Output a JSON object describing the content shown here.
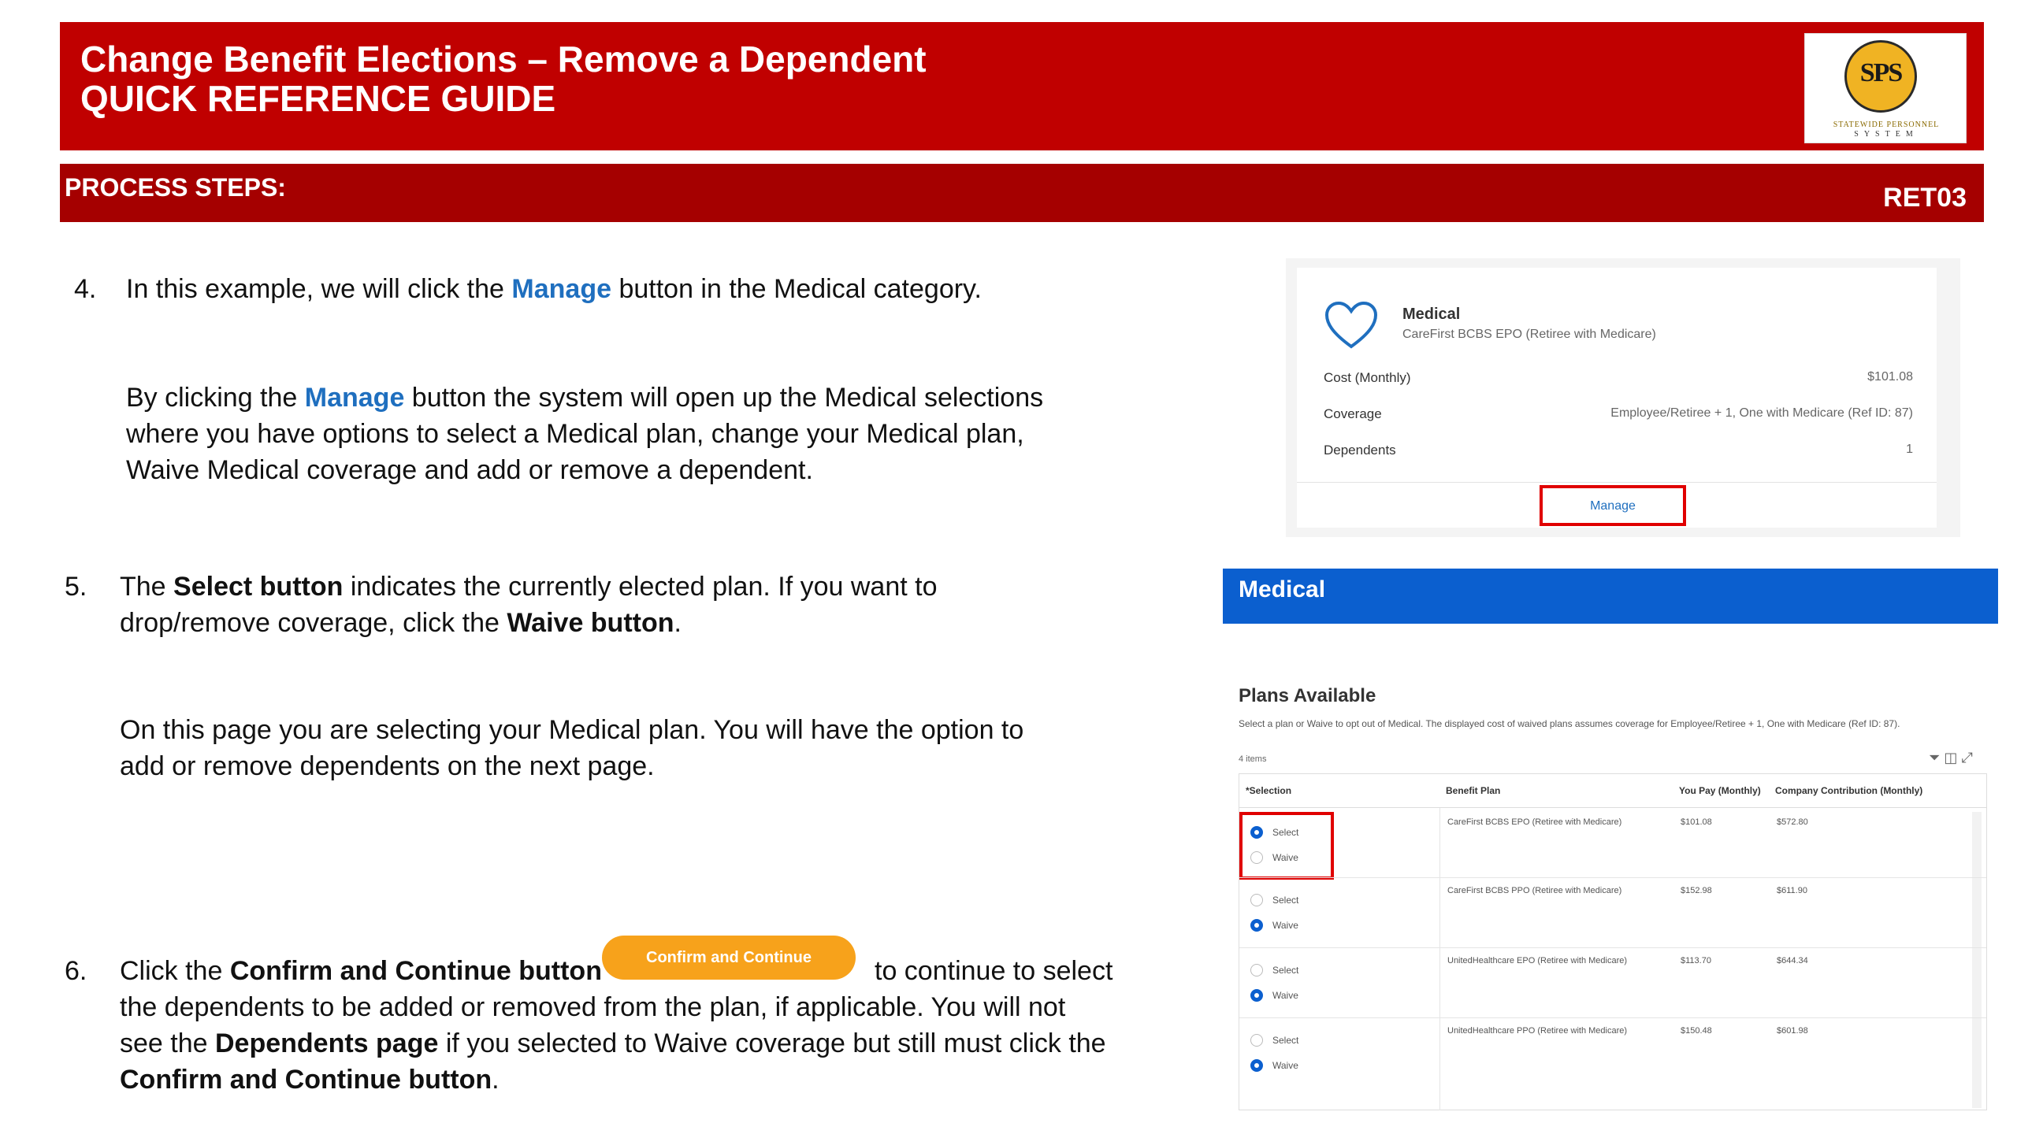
{
  "header": {
    "title_line1": "Change Benefit Elections – Remove a Dependent",
    "title_line2": "QUICK REFERENCE GUIDE",
    "logo_letters": "SPS",
    "logo_text1": "STATEWIDE PERSONNEL",
    "logo_text2": "SYSTEM"
  },
  "process_bar": {
    "label": "PROCESS STEPS:",
    "code": "RET03"
  },
  "step4": {
    "number": "4.",
    "line1_a": "In this example, we will click the ",
    "line1_b": "Manage",
    "line1_c": " button in the Medical category.",
    "para_a": "By clicking the ",
    "para_b": "Manage",
    "para_c": " button the system will open up the Medical selections",
    "para_line2": "where you have options to select a Medical plan, change your Medical plan,",
    "para_line3": "Waive Medical coverage and add or remove a dependent."
  },
  "step5": {
    "number": "5.",
    "line1_a": "The ",
    "line1_b": "Select button",
    "line1_c": " indicates the currently elected plan.  If you want to",
    "line2_a": "drop/remove coverage, click the ",
    "line2_b": "Waive button",
    "line2_c": ".",
    "para_line1": "On this page you are selecting your Medical plan.  You will have the option to",
    "para_line2": "add or remove dependents on the next page."
  },
  "step6": {
    "number": "6.",
    "line1_a": "Click the ",
    "line1_b": "Confirm and Continue button",
    "line1_c": "to continue to select",
    "line2": "the dependents to be added or removed from the plan, if applicable. You will not",
    "line3_a": "see the ",
    "line3_b": "Dependents page",
    "line3_c": " if you selected to Waive coverage but still must click the",
    "line4_a": "Confirm and Continue button",
    "line4_b": "."
  },
  "confirm_button": {
    "label": "Confirm and Continue",
    "color": "#f7a21b"
  },
  "medical_card": {
    "title": "Medical",
    "plan": "CareFirst BCBS EPO (Retiree with Medicare)",
    "rows": [
      {
        "label": "Cost (Monthly)",
        "value": "$101.08"
      },
      {
        "label": "Coverage",
        "value": "Employee/Retiree + 1, One with Medicare (Ref ID: 87)"
      },
      {
        "label": "Dependents",
        "value": "1"
      }
    ],
    "manage_label": "Manage"
  },
  "medical_banner": {
    "title": "Medical",
    "color": "#0b5fcf"
  },
  "plans": {
    "title": "Plans Available",
    "subtitle": "Select a plan or Waive to opt out of Medical. The displayed cost of waived plans assumes coverage for Employee/Retiree + 1, One with Medicare (Ref ID: 87).",
    "items_count": "4 items",
    "headers": [
      "*Selection",
      "Benefit Plan",
      "You Pay (Monthly)",
      "Company Contribution (Monthly)"
    ],
    "select_label": "Select",
    "waive_label": "Waive",
    "rows": [
      {
        "plan": "CareFirst BCBS EPO (Retiree with Medicare)",
        "you_pay": "$101.08",
        "company": "$572.80",
        "selected": "select"
      },
      {
        "plan": "CareFirst BCBS PPO (Retiree with Medicare)",
        "you_pay": "$152.98",
        "company": "$611.90",
        "selected": "waive"
      },
      {
        "plan": "UnitedHealthcare EPO (Retiree with Medicare)",
        "you_pay": "$113.70",
        "company": "$644.34",
        "selected": "waive"
      },
      {
        "plan": "UnitedHealthcare PPO (Retiree with Medicare)",
        "you_pay": "$150.48",
        "company": "$601.98",
        "selected": "waive"
      }
    ]
  }
}
